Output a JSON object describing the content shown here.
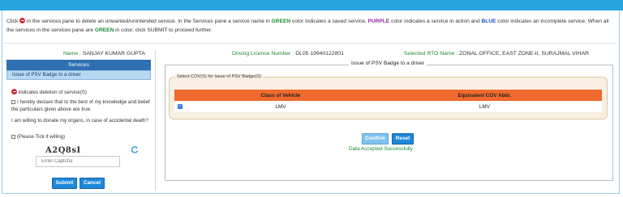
{
  "instructions": {
    "part1": "Click",
    "part2": "in the services pane to delete an unwanted/unintended service. In the Services pane a service name in",
    "green_word": "GREEN",
    "part3": "color indicates a saved service,",
    "purple_word": "PURPLE",
    "part4": "color indicates a service in action and",
    "blue_word": "BLUE",
    "part5": "color indicates an incomplete service. When all the services in the services pane are",
    "green_word2": "GREEN",
    "part6": "in color, click SUBMIT to proceed further."
  },
  "applicant": {
    "name_label": "Name :",
    "name_value": "SANJAY KUMAR GUPTA",
    "dl_label": "Driving Licence Number :",
    "dl_value": "DL05 19940122801",
    "rto_label": "Selected RTO Name :",
    "rto_value": "ZONAL OFFICE, EAST ZONE-II, SURAJMAL VIHAR"
  },
  "services": {
    "heading": "Services",
    "items": [
      {
        "label": "Issue of PSV Badge to a driver"
      }
    ]
  },
  "left": {
    "deletion_note": "indicates deletion of service(S)",
    "declaration": "I hereby declare that to the best of my knowledge and belief the particulars given above are true.",
    "organ_question": "I am willing to donate my organs, in case of accidental death?",
    "organ_tick": "(Please Tick if willing)",
    "captcha_text": "A2Q8sI",
    "captcha_placeholder": "Enter Captcha",
    "submit_label": "Submit",
    "cancel_label": "Cancel"
  },
  "main": {
    "panel_title": "Issue of PSV Badge to a driver",
    "cov_legend": "Select COV(S) for Issue of PSV Badge(S)",
    "table": {
      "headers": [
        "Class of Vehicle",
        "Equivalent COV Abbr."
      ],
      "rows": [
        {
          "checked": true,
          "class": "LMV",
          "abbr": "LMV"
        }
      ]
    },
    "confirm_label": "Confirm",
    "reset_label": "Reset",
    "status": "Data Accepted Successfully"
  },
  "colors": {
    "topbar": "#2aa3e0",
    "services_header": "#2f6fb3",
    "table_header": "#ef6a2c",
    "success": "#1b8a2e"
  }
}
